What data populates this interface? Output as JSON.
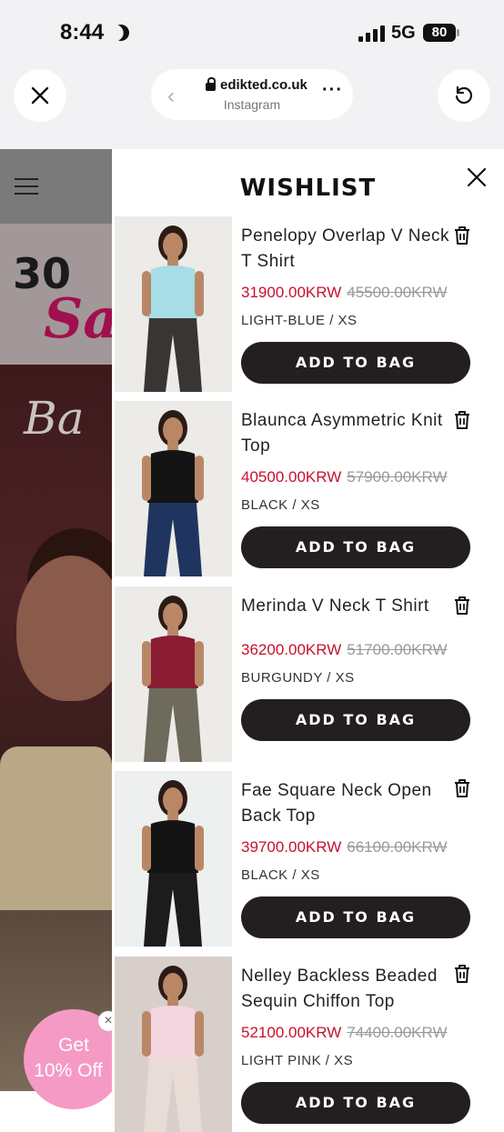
{
  "status_bar": {
    "time": "8:44",
    "network": "5G",
    "battery": "80"
  },
  "browser": {
    "url": "edikted.co.uk",
    "source": "Instagram"
  },
  "background": {
    "promo_number": "30",
    "promo_script": "Sa",
    "banner_script": "Ba",
    "popup_line1": "Get",
    "popup_line2": "10% Off"
  },
  "wishlist": {
    "title": "WISHLIST",
    "add_label": "ADD TO BAG",
    "items": [
      {
        "name": "Penelopy Overlap V Neck T Shirt",
        "price": "31900.00KRW",
        "was": "45500.00KRW",
        "variant": "LIGHT-BLUE / XS",
        "top_color": "#a7dde6",
        "bottom_color": "#3a3535",
        "bg": "#ecebe8"
      },
      {
        "name": "Blaunca Asymmetric Knit Top",
        "price": "40500.00KRW",
        "was": "57900.00KRW",
        "variant": "BLACK / XS",
        "top_color": "#141414",
        "bottom_color": "#1f3560",
        "bg": "#ecebe8"
      },
      {
        "name": "Merinda V Neck T Shirt",
        "price": "36200.00KRW",
        "was": "51700.00KRW",
        "variant": "BURGUNDY / XS",
        "top_color": "#8a1c33",
        "bottom_color": "#6e6a5c",
        "bg": "#ecebe8"
      },
      {
        "name": "Fae Square Neck Open Back Top",
        "price": "39700.00KRW",
        "was": "66100.00KRW",
        "variant": "BLACK / XS",
        "top_color": "#141414",
        "bottom_color": "#1c1c1c",
        "bg": "#eef0ef"
      },
      {
        "name": "Nelley Backless Beaded Sequin Chiffon Top",
        "price": "52100.00KRW",
        "was": "74400.00KRW",
        "variant": "LIGHT PINK / XS",
        "top_color": "#f3d6df",
        "bottom_color": "#e9dcd6",
        "bg": "#d8cfca"
      }
    ]
  }
}
